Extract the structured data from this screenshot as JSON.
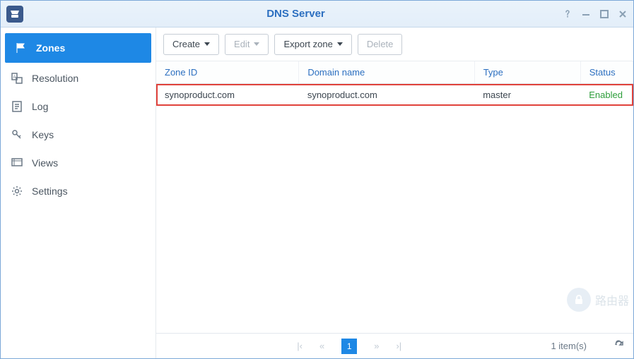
{
  "titlebar": {
    "title": "DNS Server"
  },
  "sidebar": {
    "items": [
      {
        "label": "Zones"
      },
      {
        "label": "Resolution"
      },
      {
        "label": "Log"
      },
      {
        "label": "Keys"
      },
      {
        "label": "Views"
      },
      {
        "label": "Settings"
      }
    ],
    "active_index": 0
  },
  "toolbar": {
    "create_label": "Create",
    "edit_label": "Edit",
    "export_label": "Export zone",
    "delete_label": "Delete"
  },
  "table": {
    "columns": {
      "zone_id": "Zone ID",
      "domain_name": "Domain name",
      "type": "Type",
      "status": "Status"
    },
    "rows": [
      {
        "zone_id": "synoproduct.com",
        "domain_name": "synoproduct.com",
        "type": "master",
        "status": "Enabled"
      }
    ]
  },
  "pager": {
    "current_page": "1",
    "item_count_label": "1 item(s)"
  },
  "watermark": {
    "text": "路由器"
  }
}
